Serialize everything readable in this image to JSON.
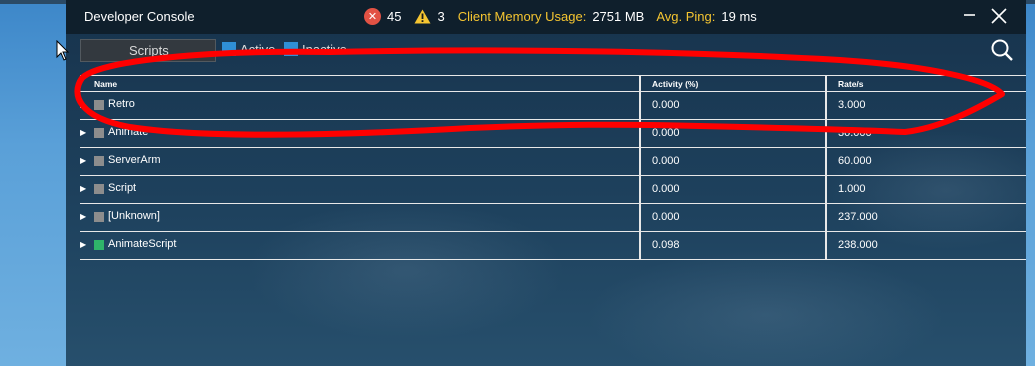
{
  "window": {
    "title": "Developer Console"
  },
  "stats": {
    "errors": "45",
    "warnings": "3",
    "memory_label": "Client Memory Usage:",
    "memory_value": "2751 MB",
    "ping_label": "Avg. Ping:",
    "ping_value": "19 ms"
  },
  "toolbar": {
    "dropdown_value": "Scripts",
    "active_label": "Active",
    "inactive_label": "Inactive"
  },
  "table": {
    "columns": [
      "Name",
      "Activity (%)",
      "Rate/s"
    ],
    "rows": [
      {
        "name": "Retro",
        "activity": "0.000",
        "rate": "3.000",
        "color": "#8d8d8d"
      },
      {
        "name": "Animate",
        "activity": "0.000",
        "rate": "30.000",
        "color": "#8d8d8d"
      },
      {
        "name": "ServerArm",
        "activity": "0.000",
        "rate": "60.000",
        "color": "#8d8d8d"
      },
      {
        "name": "Script",
        "activity": "0.000",
        "rate": "1.000",
        "color": "#8d8d8d"
      },
      {
        "name": "[Unknown]",
        "activity": "0.000",
        "rate": "237.000",
        "color": "#8d8d8d"
      },
      {
        "name": "AnimateScript",
        "activity": "0.098",
        "rate": "238.000",
        "color": "#2fb46a"
      }
    ]
  },
  "colors": {
    "accent_yellow": "#f5c531",
    "error_red": "#e25244",
    "checkbox_blue": "#2f8fd6",
    "annotation_red": "#ff0000"
  },
  "icons": {
    "error": "error-circle-icon",
    "warning": "warning-triangle-icon",
    "minimize": "minimize-icon",
    "close": "close-icon",
    "search": "search-icon",
    "expand": "expand-arrow-icon",
    "cursor": "mouse-cursor-icon"
  }
}
